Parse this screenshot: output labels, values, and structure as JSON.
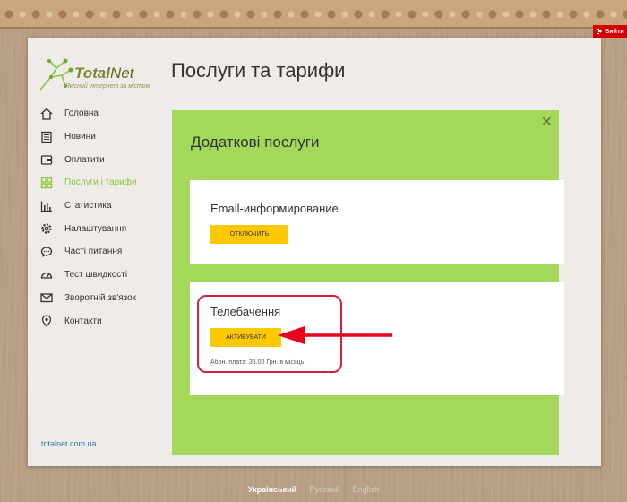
{
  "header": {
    "logout_label": "Вийти"
  },
  "logo": {
    "name_part1": "Total",
    "name_part2": "Net",
    "tagline": "Якісний інтернет за містом"
  },
  "page": {
    "title": "Послуги та тарифи"
  },
  "sidebar": {
    "items": [
      {
        "label": "Головна",
        "icon": "home-icon"
      },
      {
        "label": "Новини",
        "icon": "news-icon"
      },
      {
        "label": "Оплатити",
        "icon": "wallet-icon"
      },
      {
        "label": "Послуги і тарифи",
        "icon": "grid-icon",
        "active": true
      },
      {
        "label": "Статистика",
        "icon": "bar-chart-icon"
      },
      {
        "label": "Налаштування",
        "icon": "gear-icon"
      },
      {
        "label": "Часті питання",
        "icon": "chat-icon"
      },
      {
        "label": "Тест швидкості",
        "icon": "speedometer-icon"
      },
      {
        "label": "Зворотній зв'язок",
        "icon": "mail-icon"
      },
      {
        "label": "Контакти",
        "icon": "map-pin-icon"
      }
    ],
    "site_link": "totalnet.com.ua"
  },
  "extras": {
    "title": "Додаткові послуги",
    "services": [
      {
        "name": "Email-информирование",
        "button": "ОТКЛЮЧИТЬ"
      },
      {
        "name": "Телебачення",
        "button": "АКТИВУВАТИ",
        "fee": "Абон. плата: 35.00 Грн. в місяць"
      }
    ]
  },
  "languages": {
    "current": "Український",
    "others": [
      "Русский",
      "English"
    ]
  },
  "colors": {
    "accent": "#8cc63f",
    "panel_green": "#a3d85a",
    "button": "#ffc800",
    "highlight": "#d0223a"
  }
}
